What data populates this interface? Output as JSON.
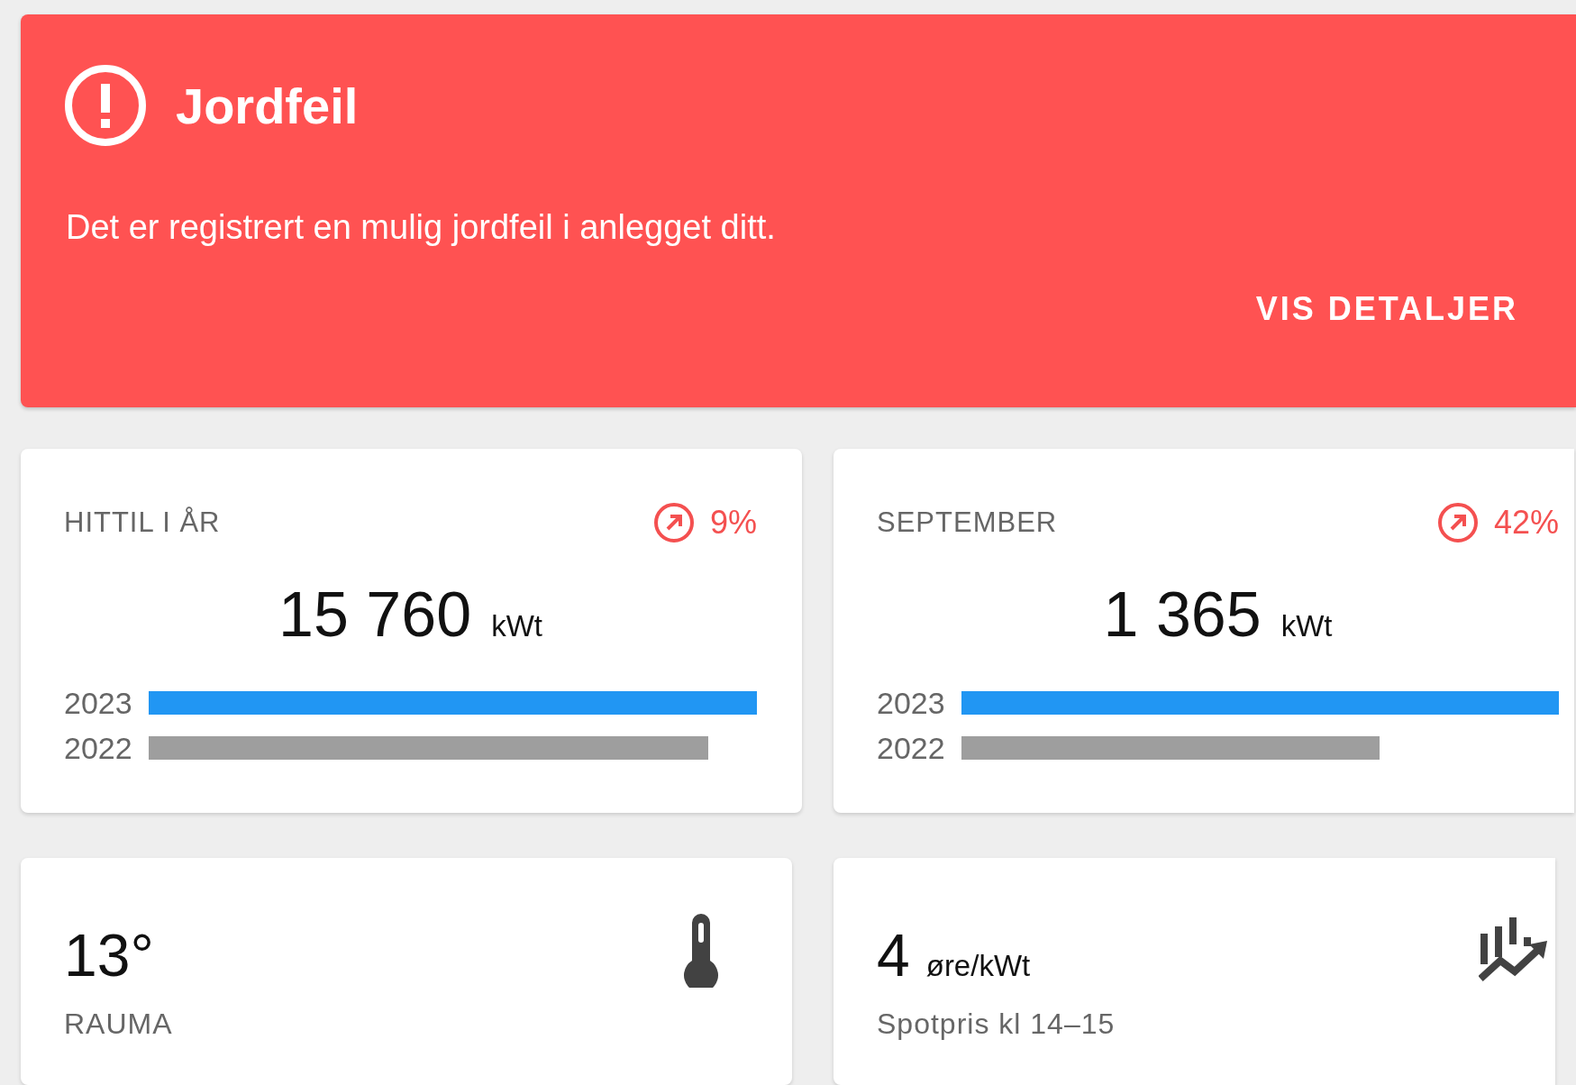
{
  "alert": {
    "title": "Jordfeil",
    "message": "Det er registrert en mulig jordfeil i anlegget ditt.",
    "action": "VIS DETALJER"
  },
  "stats": [
    {
      "label": "HITTIL I ÅR",
      "change": "9%",
      "value": "15 760",
      "unit": "kWt",
      "bars": [
        {
          "year": "2023",
          "color": "#2196f3"
        },
        {
          "year": "2022",
          "color": "#9e9e9e"
        }
      ]
    },
    {
      "label": "SEPTEMBER",
      "change": "42%",
      "value": "1 365",
      "unit": "kWt",
      "bars": [
        {
          "year": "2023",
          "color": "#2196f3"
        },
        {
          "year": "2022",
          "color": "#9e9e9e"
        }
      ]
    }
  ],
  "tiles": [
    {
      "kind": "temperature",
      "value": "13°",
      "label": "RAUMA"
    },
    {
      "kind": "price",
      "value": "4",
      "unit": "øre/kWt",
      "label": "Spotpris kl 14–15"
    }
  ]
}
